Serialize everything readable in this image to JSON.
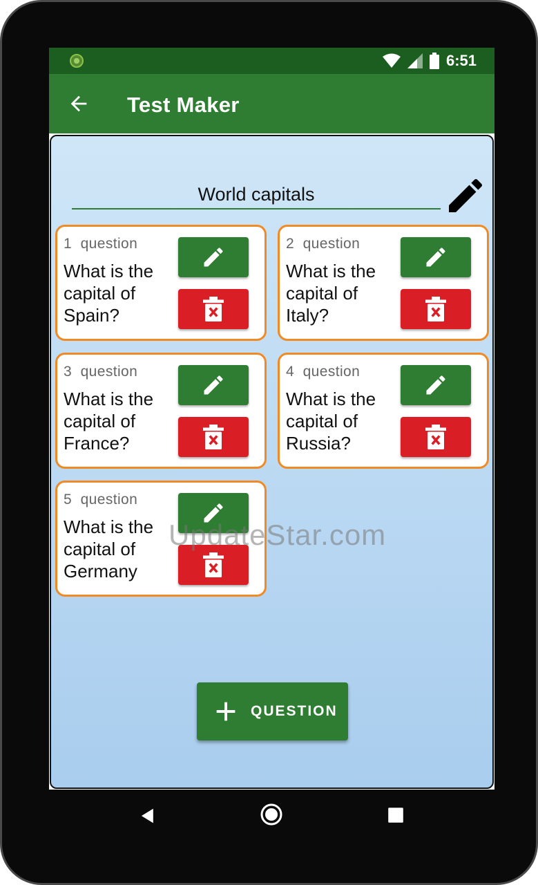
{
  "status_bar": {
    "time": "6:51"
  },
  "app_bar": {
    "title": "Test Maker"
  },
  "test": {
    "name": "World capitals"
  },
  "questions": [
    {
      "number": "1",
      "label": "question",
      "text": "What is the capital of Spain?"
    },
    {
      "number": "2",
      "label": "question",
      "text": "What is the capital of Italy?"
    },
    {
      "number": "3",
      "label": "question",
      "text": "What is the capital of France?"
    },
    {
      "number": "4",
      "label": "question",
      "text": "What is the capital of Russia?"
    },
    {
      "number": "5",
      "label": "question",
      "text": "What is the capital of Germany"
    }
  ],
  "add_button": {
    "label": "QUESTION"
  },
  "watermark": "UpdateStar.com",
  "colors": {
    "primary": "#2e7d32",
    "primary_dark": "#1b5e20",
    "delete": "#d91e25",
    "card_border": "#f08a24",
    "background": "#cfe6f7"
  },
  "icons": {
    "back": "arrow-left-icon",
    "edit_title": "pencil-icon",
    "edit": "pencil-icon",
    "delete": "trash-icon",
    "add": "plus-icon"
  }
}
